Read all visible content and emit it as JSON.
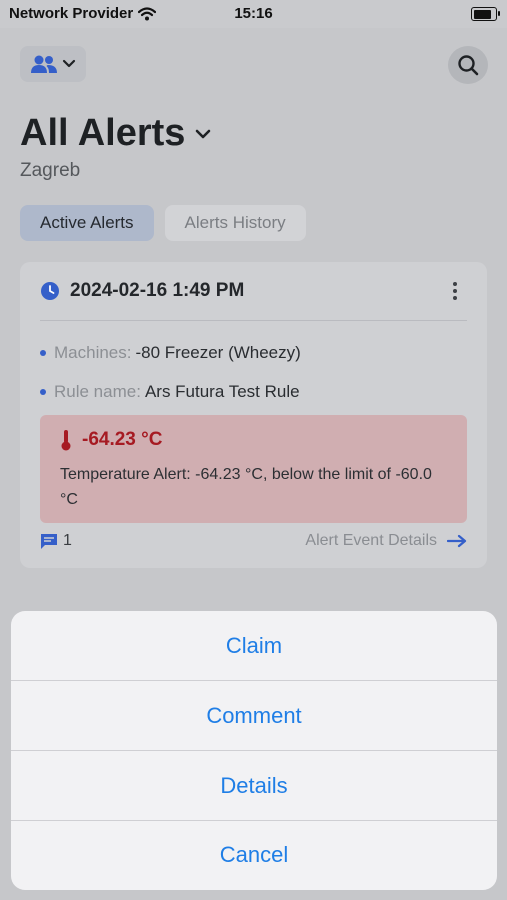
{
  "status_bar": {
    "carrier": "Network Provider",
    "time": "15:16",
    "battery_level": 0.9
  },
  "header": {
    "title": "All Alerts",
    "subtitle": "Zagreb",
    "team_icon": "people-icon",
    "search_icon": "search-icon"
  },
  "tabs": [
    {
      "label": "Active Alerts",
      "active": true
    },
    {
      "label": "Alerts History",
      "active": false
    }
  ],
  "alert_card": {
    "timestamp": "2024-02-16 1:49 PM",
    "machines_label": "Machines:",
    "machines_value": "-80 Freezer (Wheezy)",
    "rule_label": "Rule name:",
    "rule_value": "Ars Futura Test Rule",
    "temperature": "-64.23 °C",
    "description": "Temperature Alert: -64.23 °C, below the limit of -60.0 °C",
    "comment_count": "1",
    "details_link": "Alert Event Details"
  },
  "action_sheet": {
    "items": [
      "Claim",
      "Comment",
      "Details",
      "Cancel"
    ]
  },
  "colors": {
    "accent": "#1f7ee6",
    "alert_red": "#a61a22",
    "icon_blue": "#355fc9"
  }
}
